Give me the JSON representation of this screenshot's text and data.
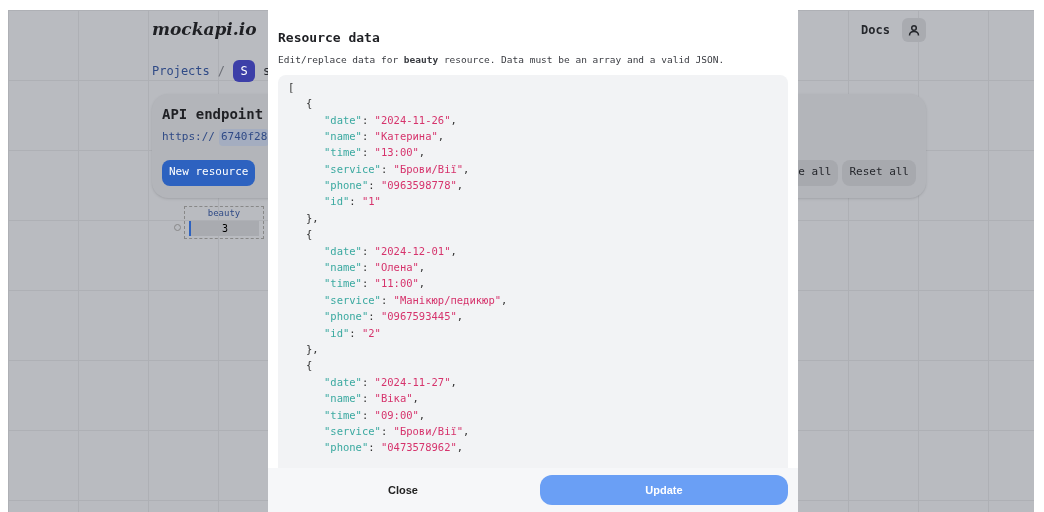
{
  "header": {
    "logo": "mockapi.io",
    "docs": "Docs"
  },
  "breadcrumb": {
    "projects": "Projects",
    "separator": "/",
    "badge": "S",
    "project": "s"
  },
  "endpoint_card": {
    "title": "API endpoint",
    "protocol": "https://",
    "host": "6740f28",
    "new_resource": "New resource",
    "buttons": [
      "e all",
      "Reset all"
    ]
  },
  "resource_node": {
    "name": "beauty",
    "count": "3"
  },
  "modal": {
    "title": "Resource data",
    "description": "Edit/replace data for **beauty** resource. Data must be an array and a valid JSON.",
    "editor": {
      "open": "[",
      "objects": [
        {
          "open": "{",
          "close": "},",
          "fields": [
            {
              "key": "\"date\"",
              "value": "\"2024-11-26\""
            },
            {
              "key": "\"name\"",
              "value": "\"Катерина\""
            },
            {
              "key": "\"time\"",
              "value": "\"13:00\""
            },
            {
              "key": "\"service\"",
              "value": "\"Брови/Вії\""
            },
            {
              "key": "\"phone\"",
              "value": "\"0963598778\""
            },
            {
              "key": "\"id\"",
              "value": "\"1\""
            }
          ]
        },
        {
          "open": "{",
          "close": "},",
          "fields": [
            {
              "key": "\"date\"",
              "value": "\"2024-12-01\""
            },
            {
              "key": "\"name\"",
              "value": "\"Олена\""
            },
            {
              "key": "\"time\"",
              "value": "\"11:00\""
            },
            {
              "key": "\"service\"",
              "value": "\"Манікюр/педикюр\""
            },
            {
              "key": "\"phone\"",
              "value": "\"0967593445\""
            },
            {
              "key": "\"id\"",
              "value": "\"2\""
            }
          ]
        },
        {
          "open": "{",
          "fields": [
            {
              "key": "\"date\"",
              "value": "\"2024-11-27\""
            },
            {
              "key": "\"name\"",
              "value": "\"Віка\""
            },
            {
              "key": "\"time\"",
              "value": "\"09:00\""
            },
            {
              "key": "\"service\"",
              "value": "\"Брови/Вії\""
            },
            {
              "key": "\"phone\"",
              "value": "\"0473578962\""
            }
          ]
        }
      ],
      "colon": ":",
      "comma": ","
    },
    "close": "Close",
    "update": "Update"
  }
}
